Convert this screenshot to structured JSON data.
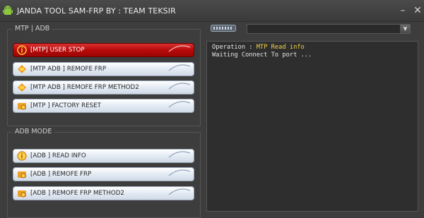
{
  "window": {
    "title": "JANDA TOOL SAM-FRP BY : TEAM TEKSIR",
    "minimize_glyph": "–",
    "close_glyph": "✕"
  },
  "mtp_group": {
    "label": "MTP | ADB",
    "buttons": [
      {
        "label": "[MTP] USER STOP",
        "icon": "info-circle-icon",
        "style": "red"
      },
      {
        "label": "[MTP ADB ] REMOFE FRP",
        "icon": "android-icon",
        "style": "normal"
      },
      {
        "label": "[MTP ADB ] REMOFE FRP METHOD2",
        "icon": "android-icon",
        "style": "normal"
      },
      {
        "label": "[MTP ] FACTORY RESET",
        "icon": "reset-icon",
        "style": "normal"
      }
    ]
  },
  "adb_group": {
    "label": "ADB MODE",
    "buttons": [
      {
        "label": "[ADB ] READ INFO",
        "icon": "info-circle-icon",
        "style": "normal"
      },
      {
        "label": "[ADB ] REMOFE FRP",
        "icon": "reset-icon",
        "style": "normal"
      },
      {
        "label": "[ADB ] REMOFE FRP METHOD2",
        "icon": "reset-icon",
        "style": "normal"
      }
    ]
  },
  "port": {
    "icon": "usb-port-icon",
    "selected": "",
    "arrow_glyph": "▼"
  },
  "log": {
    "line1_prefix": "Operation : ",
    "line1_value": "MTP Read info",
    "line2": "Waiting Connect To port ..."
  },
  "colors": {
    "background": "#3d3d3d",
    "red_button": "#b80a0a",
    "log_highlight": "#f2d24a"
  }
}
